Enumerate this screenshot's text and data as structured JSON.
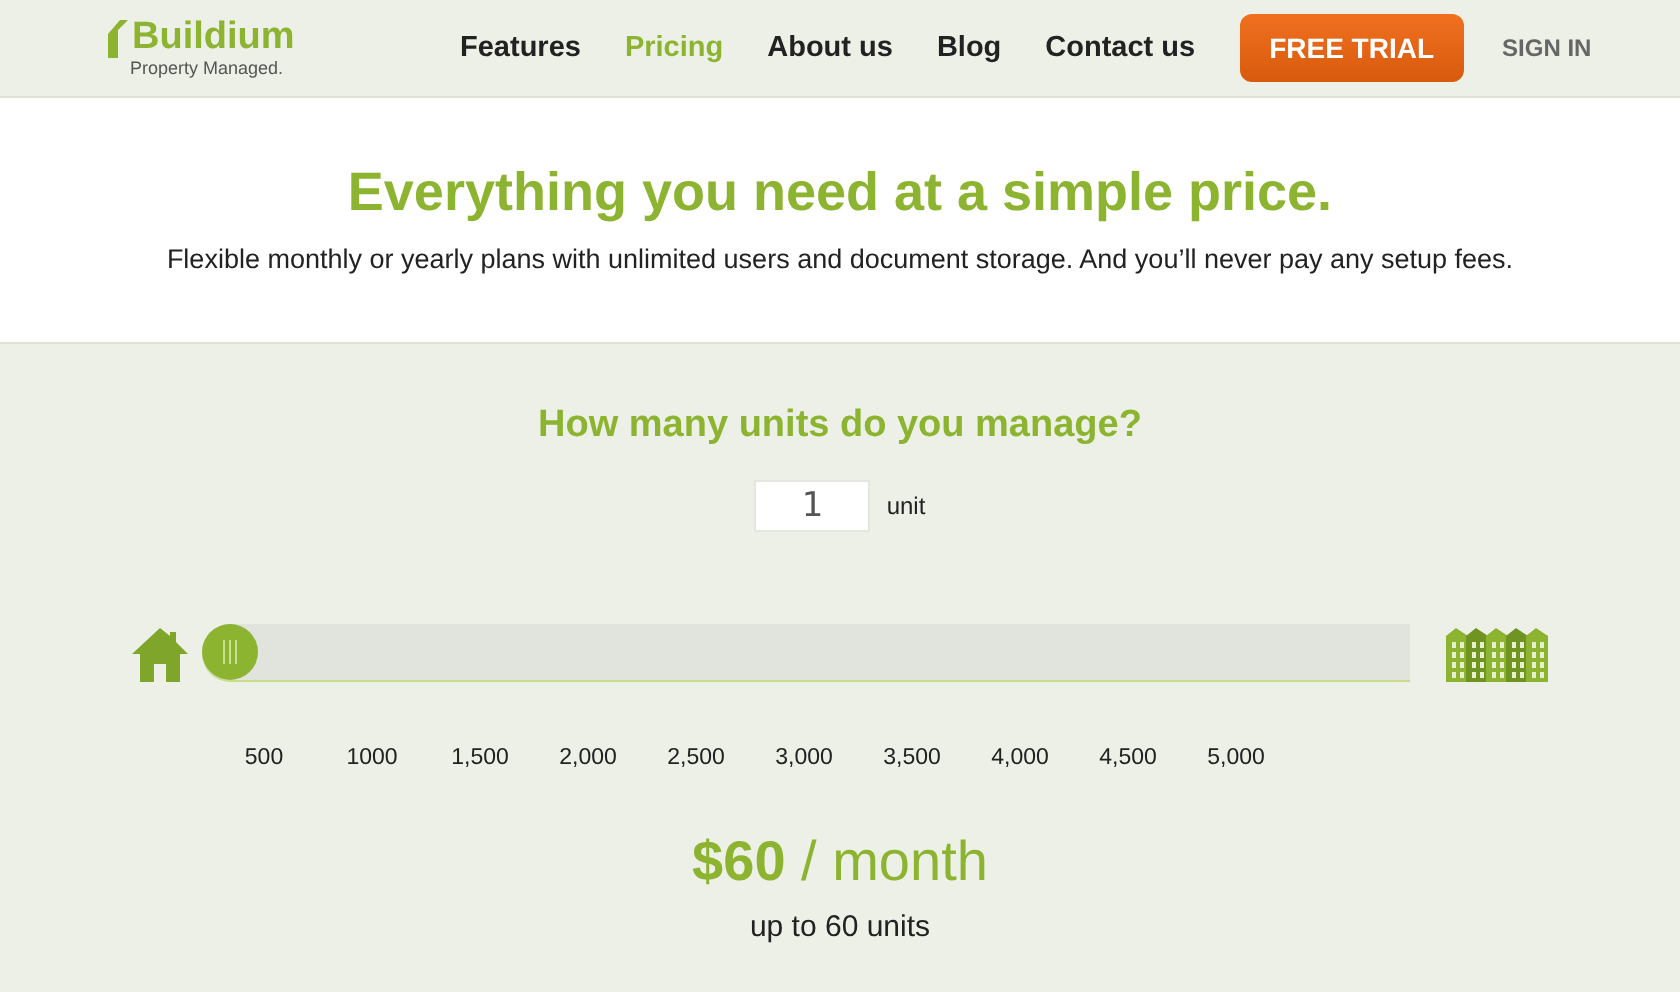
{
  "header": {
    "logo": {
      "name": "Buildium",
      "tagline": "Property Managed."
    },
    "nav": [
      {
        "label": "Features",
        "selected": false
      },
      {
        "label": "Pricing",
        "selected": true
      },
      {
        "label": "About us",
        "selected": false
      },
      {
        "label": "Blog",
        "selected": false
      },
      {
        "label": "Contact us",
        "selected": false
      }
    ],
    "cta": "FREE TRIAL",
    "sign_in": "SIGN IN"
  },
  "hero": {
    "title": "Everything you need at a simple price.",
    "subtitle": "Flexible monthly or yearly plans with unlimited users and document storage. And you’ll never pay any setup fees."
  },
  "calculator": {
    "question": "How many units do you manage?",
    "units_value": "1",
    "units_label": "unit",
    "slider": {
      "level": 0
    },
    "ticks": [
      "500",
      "1000",
      "1,500",
      "2,000",
      "2,500",
      "3,000",
      "3,500",
      "4,000",
      "4,500",
      "5,000"
    ],
    "price": "**$60** / month",
    "limit": "up to 60 units"
  }
}
